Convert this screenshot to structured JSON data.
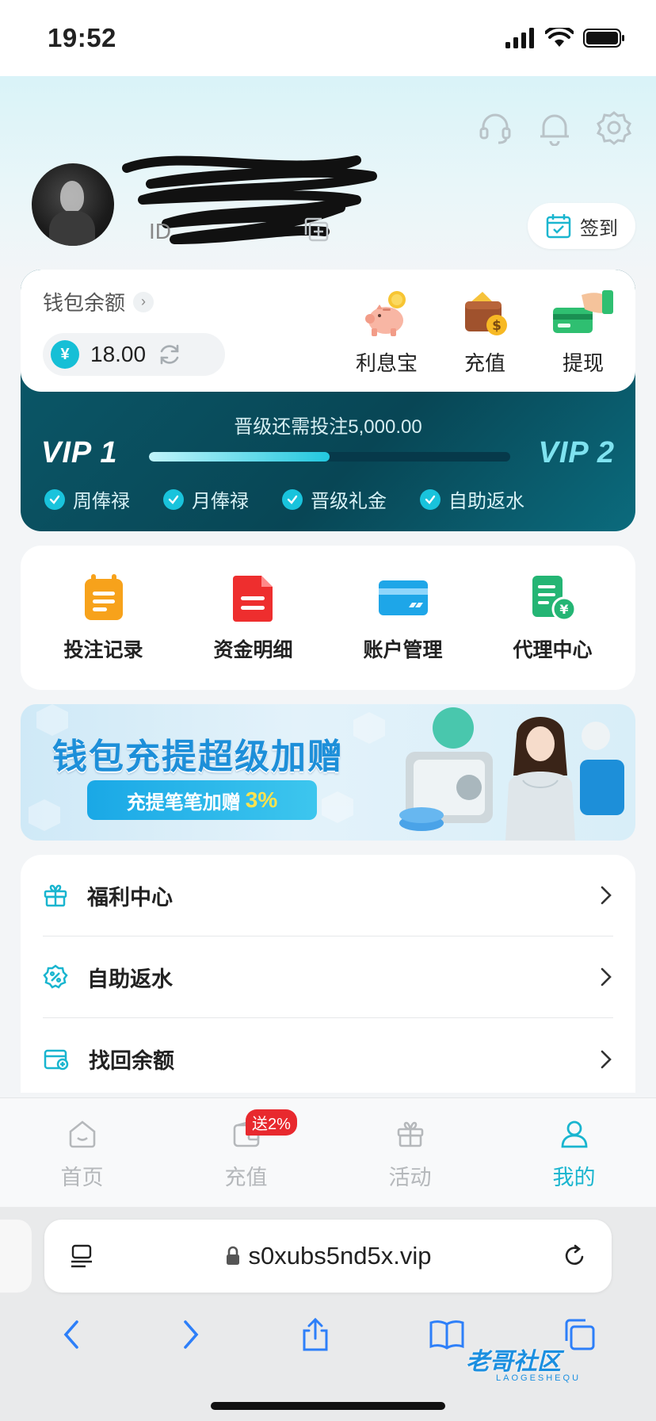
{
  "status": {
    "time": "19:52"
  },
  "profile": {
    "id_label": "ID",
    "checkin_label": "签到"
  },
  "wallet": {
    "title": "钱包余额",
    "balance": "18.00",
    "currency_symbol": "¥",
    "actions": [
      {
        "label": "利息宝",
        "icon": "piggy-bank-icon"
      },
      {
        "label": "充值",
        "icon": "wallet-coin-icon"
      },
      {
        "label": "提现",
        "icon": "card-withdraw-icon"
      }
    ]
  },
  "vip": {
    "progress_text": "晋级还需投注5,000.00",
    "current": "VIP 1",
    "next": "VIP 2",
    "progress": 0.5,
    "perks": [
      "周俸禄",
      "月俸禄",
      "晋级礼金",
      "自助返水"
    ]
  },
  "menu": [
    {
      "label": "投注记录",
      "icon": "clipboard-icon"
    },
    {
      "label": "资金明细",
      "icon": "document-icon"
    },
    {
      "label": "账户管理",
      "icon": "card-icon"
    },
    {
      "label": "代理中心",
      "icon": "agent-doc-icon"
    }
  ],
  "banner": {
    "title": "钱包充提超级加赠",
    "subtitle": "充提笔笔加赠",
    "percent": "3%"
  },
  "list": [
    {
      "label": "福利中心",
      "icon": "gift-icon"
    },
    {
      "label": "自助返水",
      "icon": "rebate-icon"
    },
    {
      "label": "找回余额",
      "icon": "recover-icon"
    }
  ],
  "tabs": [
    {
      "label": "首页",
      "icon": "home-icon"
    },
    {
      "label": "充值",
      "icon": "wallet-icon",
      "badge": "送2%"
    },
    {
      "label": "活动",
      "icon": "gift-icon"
    },
    {
      "label": "我的",
      "icon": "user-icon",
      "active": true
    }
  ],
  "browser": {
    "url": "s0xubs5nd5x.vip"
  },
  "watermark": {
    "text": "老哥社区",
    "sub": "LAOGESHEQU"
  },
  "colors": {
    "accent": "#19b5cf",
    "vip_dark": "#084655",
    "badge_red": "#e8292e"
  }
}
